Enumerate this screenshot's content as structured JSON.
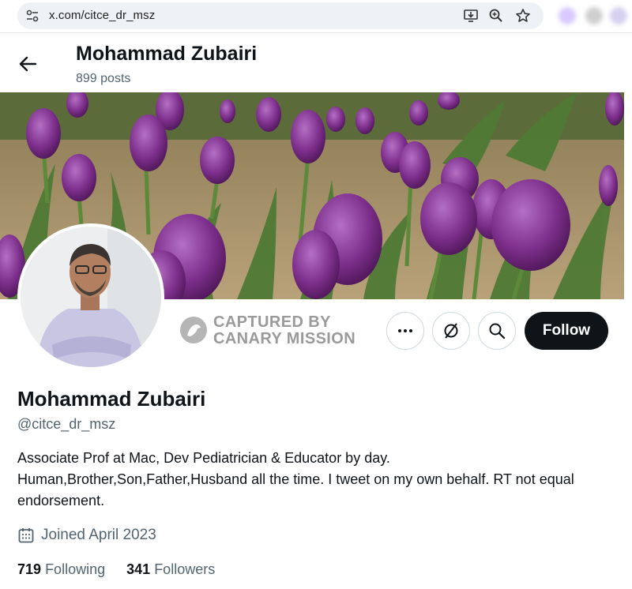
{
  "browser": {
    "url": "x.com/citce_dr_msz",
    "icons": [
      "site-info-icon",
      "install-app-icon",
      "zoom-icon",
      "bookmark-star-icon"
    ]
  },
  "header": {
    "back_icon": "back-arrow-icon",
    "name": "Mohammad Zubairi",
    "posts": "899 posts"
  },
  "watermark": {
    "line1": "CAPTURED BY",
    "line2": "CANARY MISSION"
  },
  "actions": {
    "more_icon": "more-icon",
    "grok_icon": "grok-icon",
    "search_icon": "search-icon",
    "follow_label": "Follow"
  },
  "profile": {
    "display_name": "Mohammad Zubairi",
    "handle": "@citce_dr_msz",
    "bio": "Associate Prof at Mac, Dev Pediatrician & Educator by day. Human,Brother,Son,Father,Husband all the time. I tweet on my own behalf. RT not equal endorsement.",
    "joined": "Joined April 2023",
    "following_count": "719",
    "following_label": "Following",
    "followers_count": "341",
    "followers_label": "Followers"
  },
  "colors": {
    "accent": "#0f1419",
    "secondary_text": "#536471",
    "tulip": "#7a2c86"
  }
}
